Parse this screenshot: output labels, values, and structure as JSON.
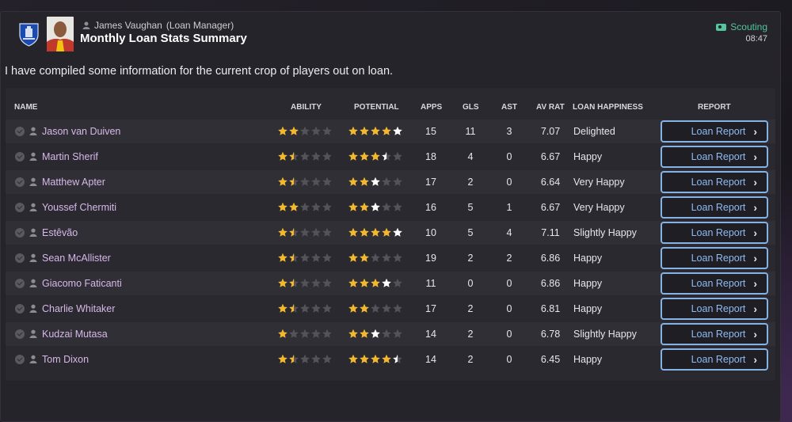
{
  "header": {
    "sender_name": "James Vaughan",
    "sender_role": "(Loan Manager)",
    "title": "Monthly Loan Stats Summary",
    "scouting_label": "Scouting",
    "time": "08:47",
    "icons": [
      "club-badge-icon",
      "person-icon",
      "scouting-tag-icon"
    ]
  },
  "intro": "I have compiled some information for the current crop of players out on loan.",
  "columns": [
    "NAME",
    "ABILITY",
    "POTENTIAL",
    "APPS",
    "GLS",
    "AST",
    "AV RAT",
    "LOAN HAPPINESS",
    "REPORT"
  ],
  "colors": {
    "star_gold": "#f2b82e",
    "star_white": "#ffffff",
    "star_empty": "#55535a",
    "name": "#d6b8e8",
    "button_border": "#84b2e4",
    "scouting": "#53c49b"
  },
  "players": [
    {
      "name": "Jason van Duiven",
      "ability": 2,
      "potential": 5,
      "potential_white": 1,
      "apps": "15",
      "gls": "11",
      "ast": "3",
      "rating": "7.07",
      "happiness": "Delighted",
      "report": "Loan Report"
    },
    {
      "name": "Martin Sherif",
      "ability": 1.5,
      "potential": 3.5,
      "potential_white": 0.5,
      "apps": "18",
      "gls": "4",
      "ast": "0",
      "rating": "6.67",
      "happiness": "Happy",
      "report": "Loan Report"
    },
    {
      "name": "Matthew Apter",
      "ability": 1.5,
      "potential": 3,
      "potential_white": 1,
      "apps": "17",
      "gls": "2",
      "ast": "0",
      "rating": "6.64",
      "happiness": "Very Happy",
      "report": "Loan Report"
    },
    {
      "name": "Youssef Chermiti",
      "ability": 2,
      "potential": 3,
      "potential_white": 1,
      "apps": "16",
      "gls": "5",
      "ast": "1",
      "rating": "6.67",
      "happiness": "Very Happy",
      "report": "Loan Report"
    },
    {
      "name": "Estêvão",
      "ability": 1.5,
      "potential": 5,
      "potential_white": 1,
      "apps": "10",
      "gls": "5",
      "ast": "4",
      "rating": "7.11",
      "happiness": "Slightly Happy",
      "report": "Loan Report"
    },
    {
      "name": "Sean McAllister",
      "ability": 1.5,
      "potential": 2,
      "potential_white": 0,
      "apps": "19",
      "gls": "2",
      "ast": "2",
      "rating": "6.86",
      "happiness": "Happy",
      "report": "Loan Report"
    },
    {
      "name": "Giacomo Faticanti",
      "ability": 1.5,
      "potential": 4,
      "potential_white": 1,
      "apps": "11",
      "gls": "0",
      "ast": "0",
      "rating": "6.86",
      "happiness": "Happy",
      "report": "Loan Report"
    },
    {
      "name": "Charlie Whitaker",
      "ability": 1.5,
      "potential": 2,
      "potential_white": 0,
      "apps": "17",
      "gls": "2",
      "ast": "0",
      "rating": "6.81",
      "happiness": "Happy",
      "report": "Loan Report"
    },
    {
      "name": "Kudzai Mutasa",
      "ability": 1,
      "potential": 3,
      "potential_white": 1,
      "apps": "14",
      "gls": "2",
      "ast": "0",
      "rating": "6.78",
      "happiness": "Slightly Happy",
      "report": "Loan Report"
    },
    {
      "name": "Tom Dixon",
      "ability": 1.5,
      "potential": 4.5,
      "potential_white": 0.5,
      "apps": "14",
      "gls": "2",
      "ast": "0",
      "rating": "6.45",
      "happiness": "Happy",
      "report": "Loan Report"
    }
  ]
}
